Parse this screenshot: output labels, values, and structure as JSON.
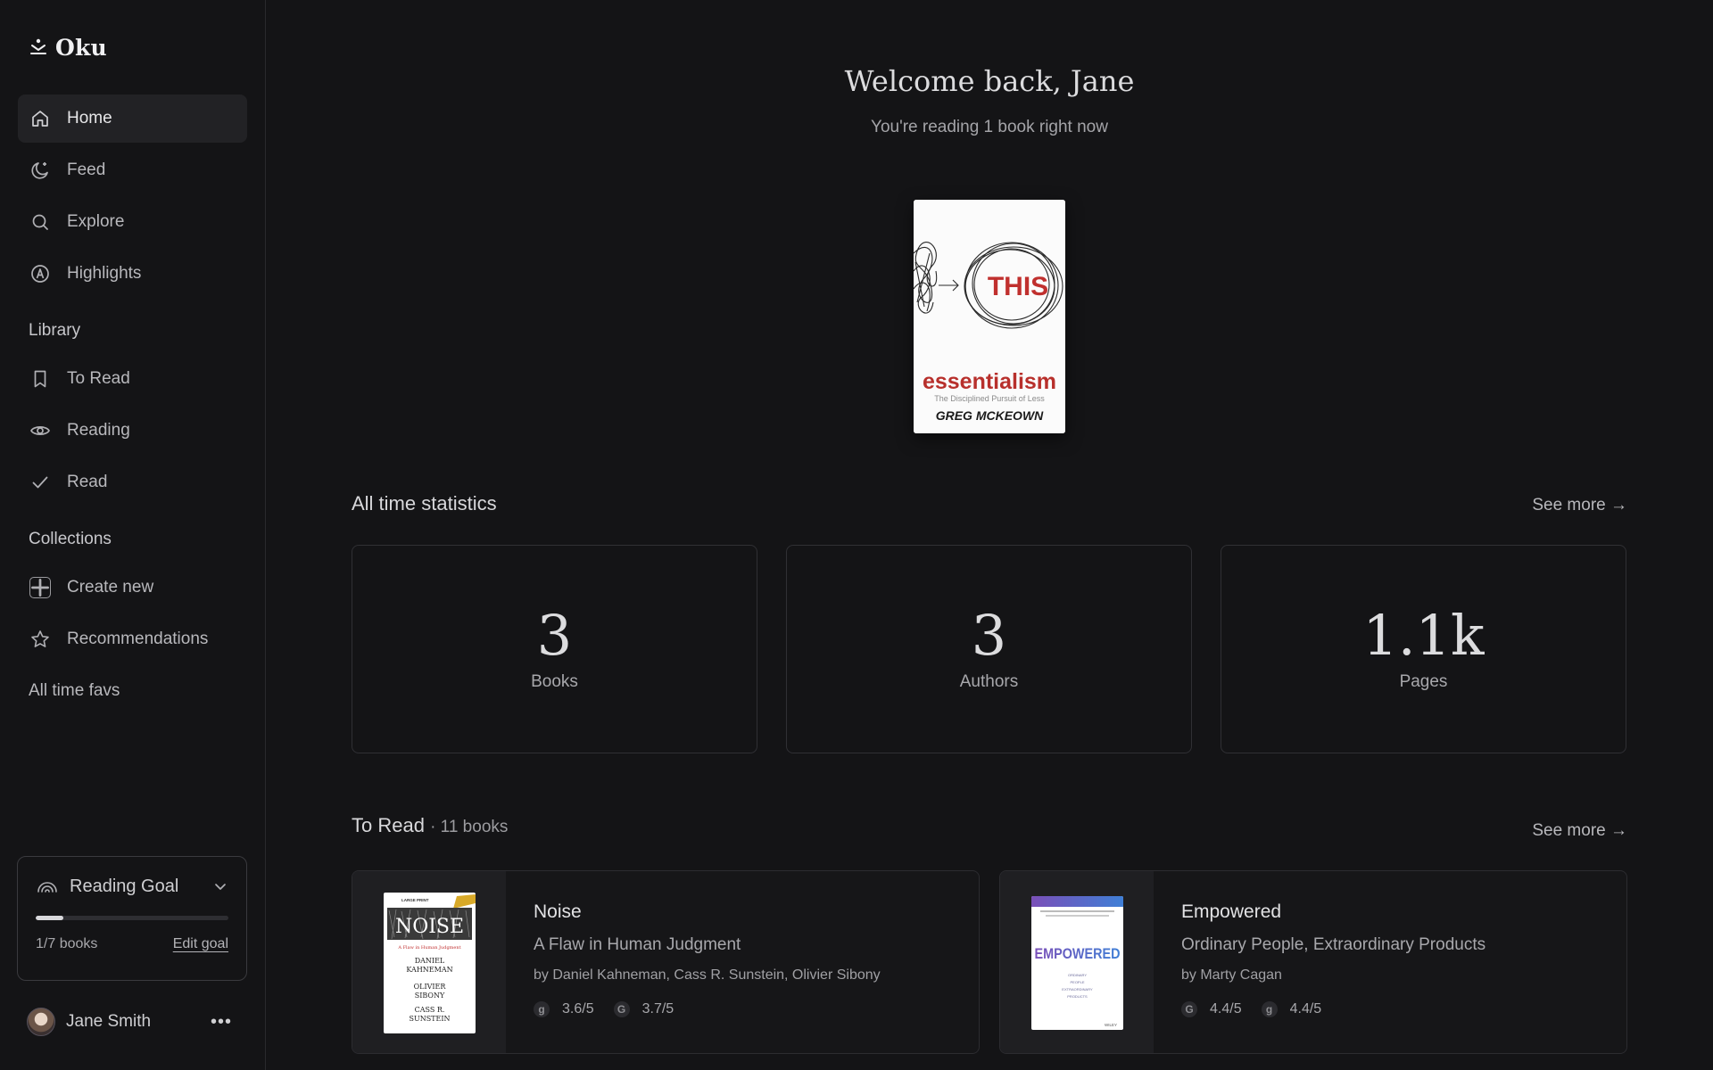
{
  "app": {
    "name": "Oku"
  },
  "nav": {
    "home": "Home",
    "feed": "Feed",
    "explore": "Explore",
    "highlights": "Highlights"
  },
  "library": {
    "label": "Library",
    "to_read": "To Read",
    "reading": "Reading",
    "read": "Read"
  },
  "collections": {
    "label": "Collections",
    "create_new": "Create new",
    "recommendations": "Recommendations",
    "all_time_favs": "All time favs"
  },
  "goal": {
    "label": "Reading Goal",
    "progress_text": "1/7 books",
    "progress_fraction": 0.143,
    "edit": "Edit goal"
  },
  "user": {
    "name": "Jane Smith"
  },
  "welcome": {
    "title": "Welcome back, Jane",
    "subtitle": "You're reading 1 book right now"
  },
  "current_book": {
    "cover_word": "THIS",
    "cover_title": "essentialism",
    "cover_subtitle": "The Disciplined Pursuit of Less",
    "cover_author": "GREG MCKEOWN"
  },
  "stats": {
    "title": "All time statistics",
    "see_more": "See more →",
    "items": [
      {
        "value": "3",
        "label": "Books"
      },
      {
        "value": "3",
        "label": "Authors"
      },
      {
        "value": "1.1k",
        "label": "Pages"
      }
    ]
  },
  "to_read": {
    "title": "To Read",
    "count": "· 11 books",
    "see_more": "See more →",
    "books": [
      {
        "title": "Noise",
        "subtitle": "A Flaw in Human Judgment",
        "authors": "by Daniel Kahneman, Cass R. Sunstein, Olivier Sibony",
        "rating1_badge": "g",
        "rating1": "3.6/5",
        "rating2_badge": "G",
        "rating2": "3.7/5",
        "cover": {
          "top": "LARGE PRINT",
          "word": "NOISE",
          "tag": "A Flaw in Human Judgment",
          "a1": "DANIEL",
          "a2": "KAHNEMAN",
          "a3": "OLIVIER",
          "a4": "SIBONY",
          "a5": "CASS R.",
          "a6": "SUNSTEIN"
        }
      },
      {
        "title": "Empowered",
        "subtitle": "Ordinary People, Extraordinary Products",
        "authors": "by Marty Cagan",
        "rating1_badge": "G",
        "rating1": "4.4/5",
        "rating2_badge": "g",
        "rating2": "4.4/5",
        "cover": {
          "word": "EMPOWERED",
          "l1": "ORDINARY",
          "l2": "PEOPLE",
          "l3": "EXTRAORDINARY",
          "l4": "PRODUCTS",
          "pub": "WILEY"
        }
      }
    ]
  }
}
